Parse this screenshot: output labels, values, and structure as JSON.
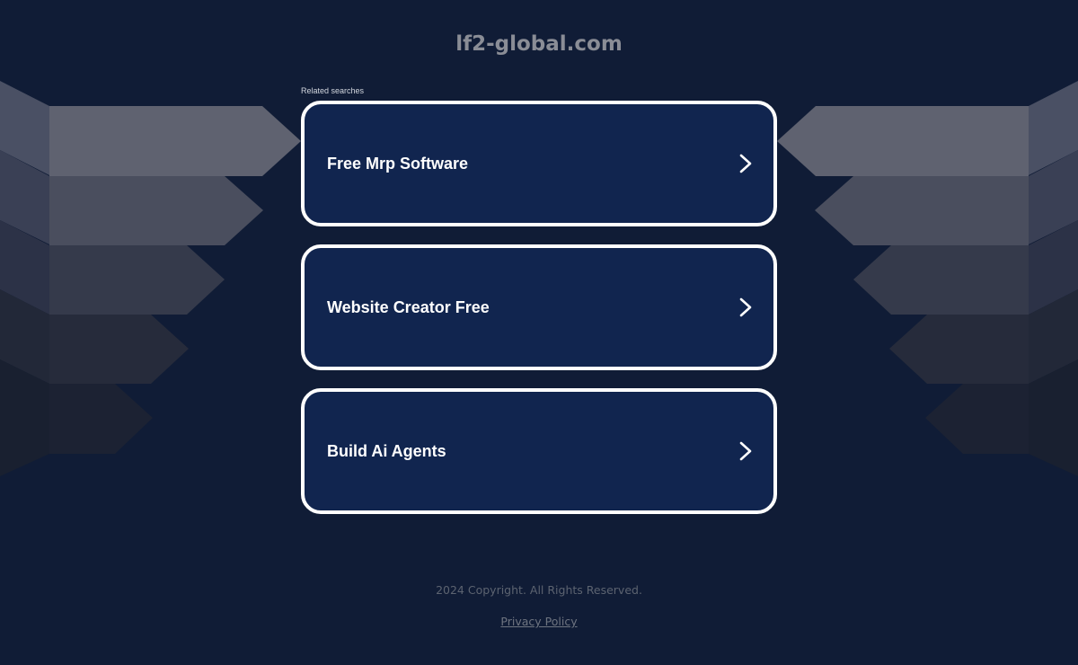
{
  "site": {
    "title": "lf2-global.com"
  },
  "related": {
    "label": "Related searches",
    "items": [
      {
        "label": "Free Mrp Software",
        "icon": "chevron-right-icon"
      },
      {
        "label": "Website Creator Free",
        "icon": "chevron-right-icon"
      },
      {
        "label": "Build Ai Agents",
        "icon": "chevron-right-icon"
      }
    ]
  },
  "footer": {
    "copyright": "2024 Copyright. All Rights Reserved.",
    "privacy_label": "Privacy Policy"
  },
  "colors": {
    "background": "#101c36",
    "card_fill": "#11254f",
    "card_border": "#ffffff",
    "title_text": "#8a8d96",
    "footer_text": "#5c6370"
  }
}
